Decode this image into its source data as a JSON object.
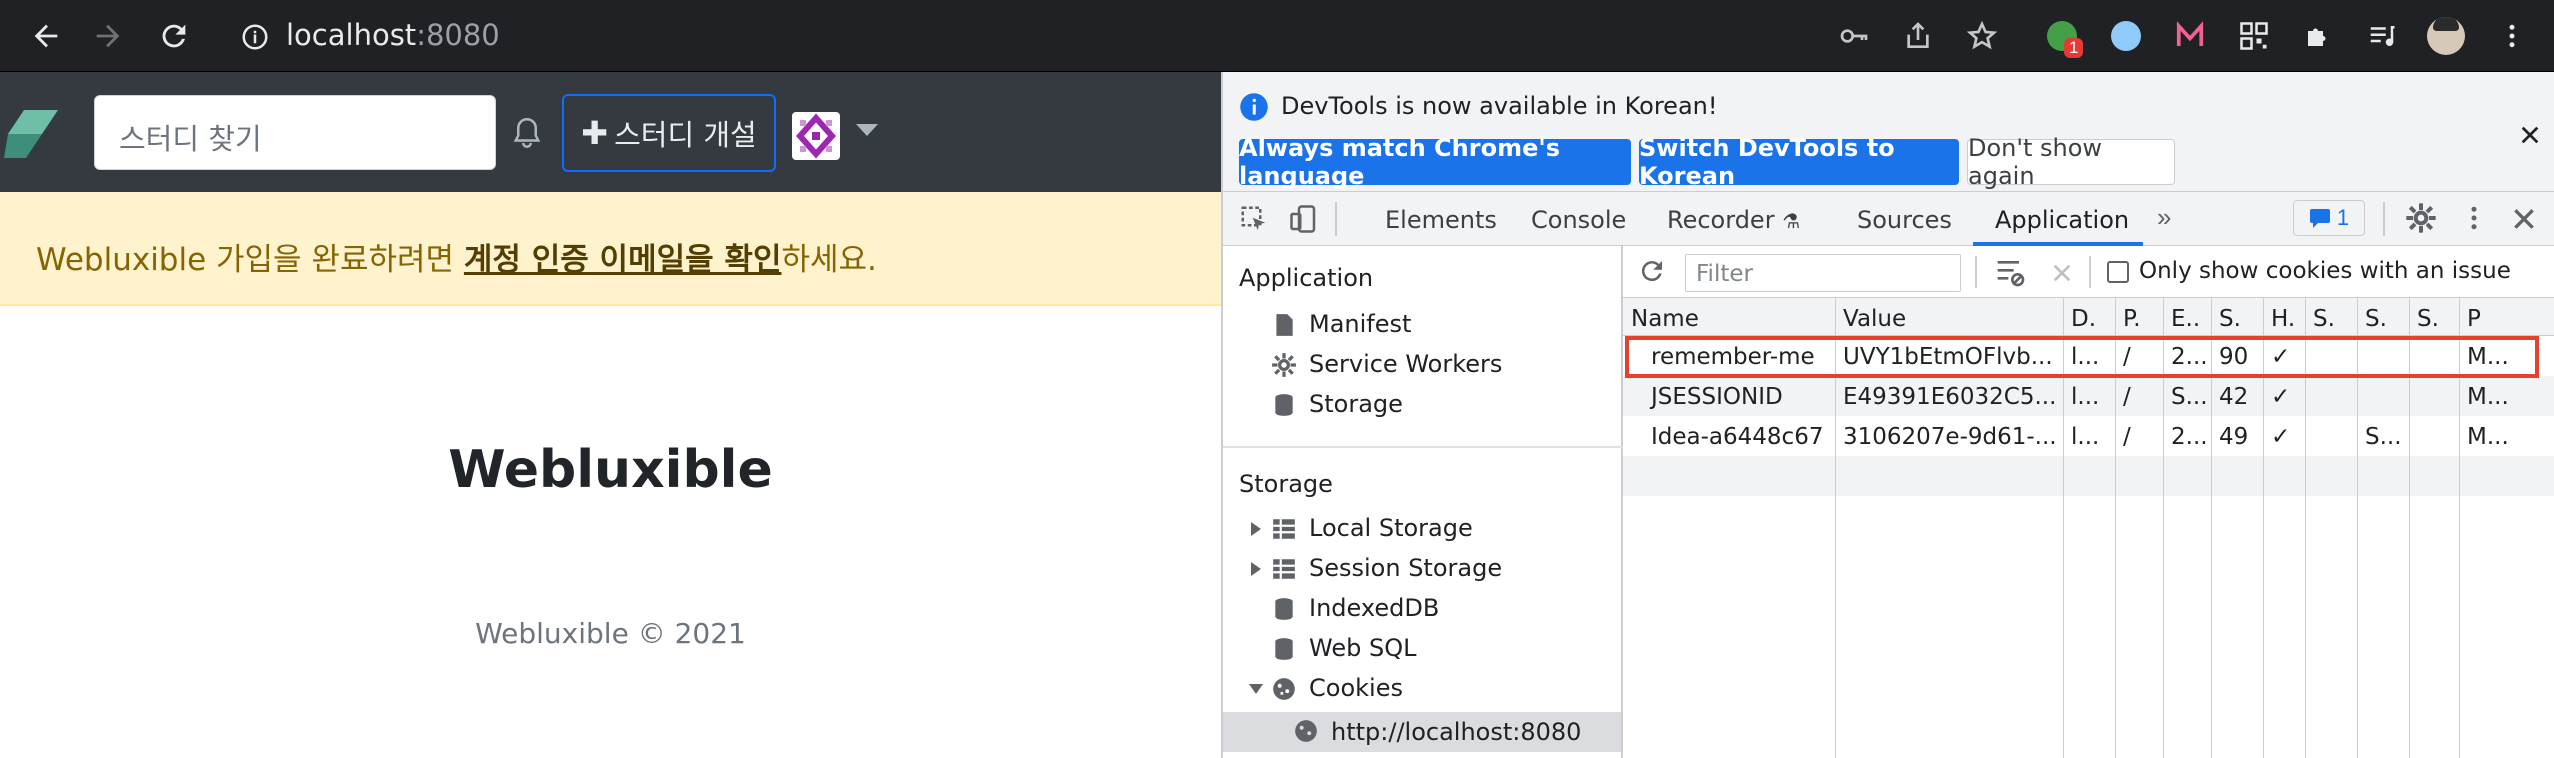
{
  "browser": {
    "url_host": "localhost",
    "url_port": ":8080",
    "extension_badge": "1"
  },
  "site": {
    "search_placeholder": "스터디 찾기",
    "create_study_label": "스터디 개설",
    "banner_prefix": "Webluxible 가입을 완료하려면 ",
    "banner_link": "계정 인증 이메일을 확인",
    "banner_suffix": "하세요.",
    "brand_title": "Webluxible",
    "footer": "Webluxible © 2021"
  },
  "devtools": {
    "info_message": "DevTools is now available in Korean!",
    "btn_match": "Always match Chrome's language",
    "btn_switch": "Switch DevTools to Korean",
    "btn_dismiss": "Don't show again",
    "tabs": [
      "Elements",
      "Console",
      "Recorder",
      "Sources",
      "Application"
    ],
    "issues_count": "1",
    "sidebar": {
      "app_header": "Application",
      "app_items": [
        "Manifest",
        "Service Workers",
        "Storage"
      ],
      "storage_header": "Storage",
      "storage_items": [
        "Local Storage",
        "Session Storage",
        "IndexedDB",
        "Web SQL",
        "Cookies"
      ],
      "cookie_origin": "http://localhost:8080"
    },
    "filter_placeholder": "Filter",
    "only_issue_label": "Only show cookies with an issue",
    "columns": [
      "Name",
      "Value",
      "D.",
      "P.",
      "E..",
      "S.",
      "H.",
      "S.",
      "S.",
      "S.",
      "P"
    ],
    "rows": [
      [
        "remember-me",
        "UVY1bEtmOFlvb...",
        "l...",
        "/",
        "2...",
        "90",
        "✓",
        "",
        "",
        "",
        "M..."
      ],
      [
        "JSESSIONID",
        "E49391E6032C5...",
        "l...",
        "/",
        "S...",
        "42",
        "✓",
        "",
        "",
        "",
        "M..."
      ],
      [
        "Idea-a6448c67",
        "3106207e-9d61-...",
        "l...",
        "/",
        "2...",
        "49",
        "✓",
        "",
        "S...",
        "",
        "M..."
      ]
    ],
    "highlight_color": "#e8402f"
  }
}
